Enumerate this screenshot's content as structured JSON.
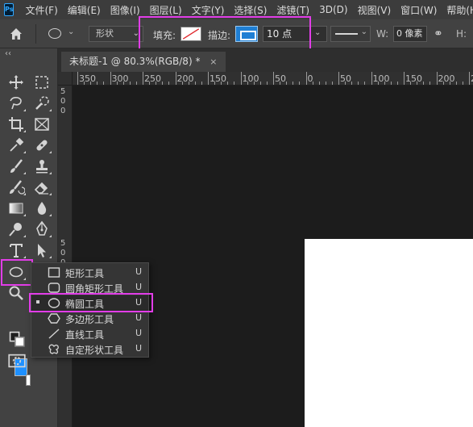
{
  "app": {
    "logo_text": "Ps"
  },
  "menu": [
    "文件(F)",
    "编辑(E)",
    "图像(I)",
    "图层(L)",
    "文字(Y)",
    "选择(S)",
    "滤镜(T)",
    "3D(D)",
    "视图(V)",
    "窗口(W)",
    "帮助(H)"
  ],
  "options": {
    "mode": "形状",
    "fill_label": "填充:",
    "stroke_label": "描边:",
    "stroke_width": "10 点",
    "w_label": "W:",
    "w_value": "0 像素",
    "h_label": "H:"
  },
  "document": {
    "tab_title": "未标题-1 @ 80.3%(RGB/8) *",
    "close": "×"
  },
  "ruler": {
    "h_labels": [
      "350",
      "300",
      "250",
      "200",
      "150",
      "100",
      "50",
      "0",
      "50",
      "100",
      "150",
      "200",
      "250"
    ],
    "v_labels": [
      "5",
      "0",
      "0",
      "5",
      "0",
      "0",
      "0",
      "0"
    ]
  },
  "flyout": {
    "items": [
      {
        "label": "矩形工具",
        "key": "U",
        "icon": "rectangle-icon",
        "selected": false
      },
      {
        "label": "圆角矩形工具",
        "key": "U",
        "icon": "rounded-rectangle-icon",
        "selected": false
      },
      {
        "label": "椭圆工具",
        "key": "U",
        "icon": "ellipse-icon",
        "selected": true
      },
      {
        "label": "多边形工具",
        "key": "U",
        "icon": "polygon-icon",
        "selected": false
      },
      {
        "label": "直线工具",
        "key": "U",
        "icon": "line-icon",
        "selected": false
      },
      {
        "label": "自定形状工具",
        "key": "U",
        "icon": "custom-shape-icon",
        "selected": false
      }
    ]
  },
  "colors": {
    "foreground": "#1e90ff",
    "background": "#ffffff",
    "highlight": "#e23de8",
    "stroke": "#1f7fd4"
  }
}
